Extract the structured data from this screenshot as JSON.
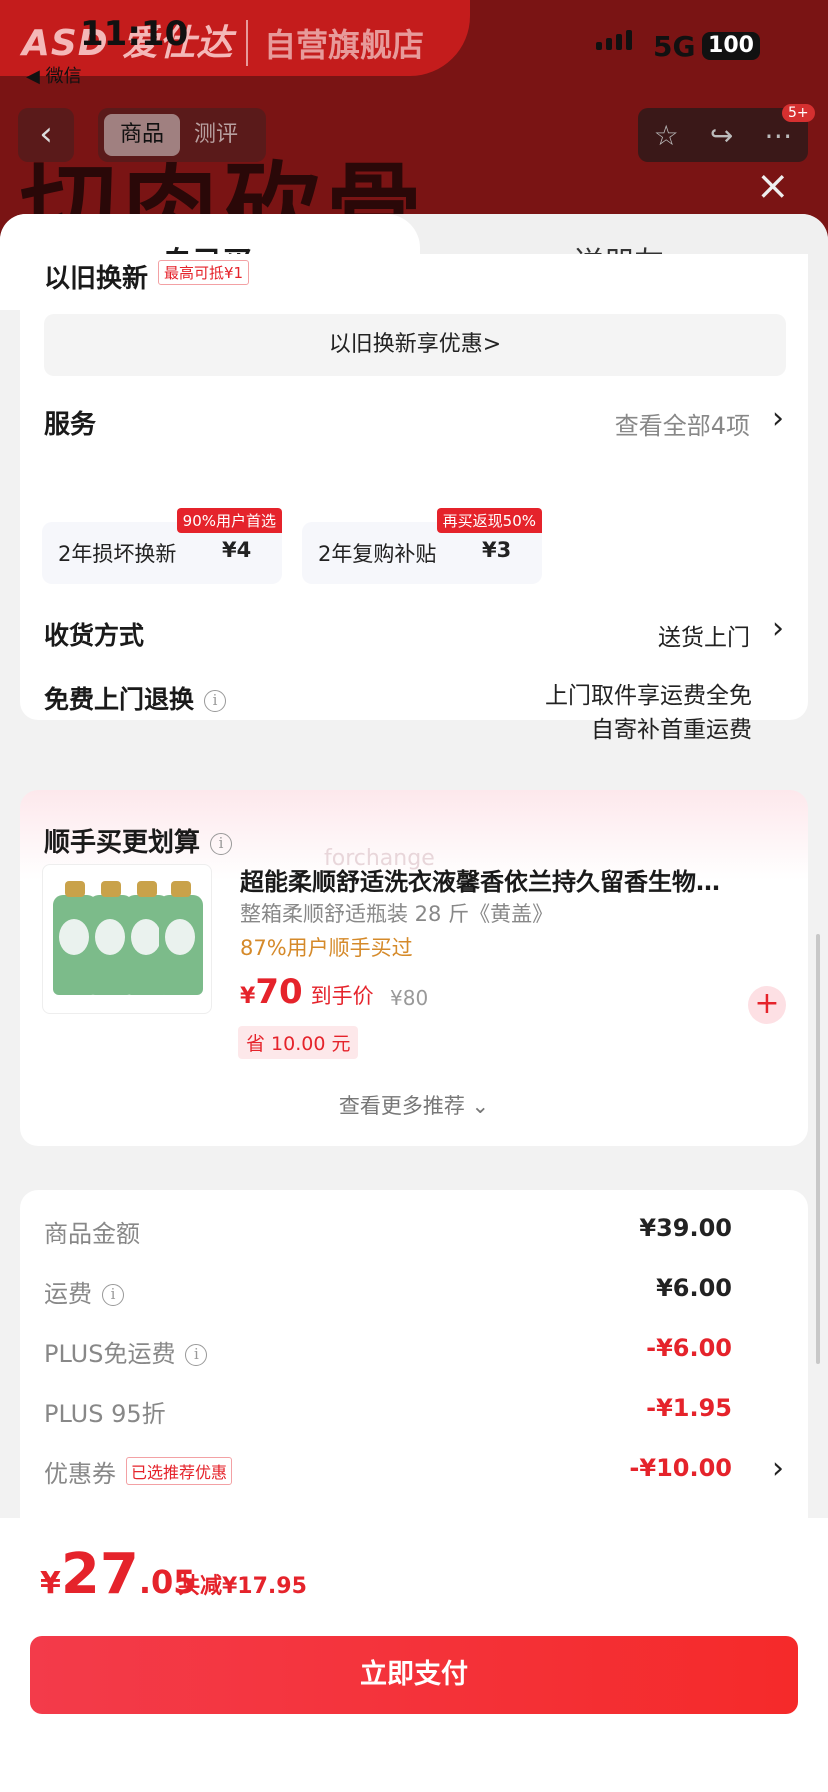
{
  "status_bar": {
    "time": "11:10",
    "back_app": "◀ 微信",
    "network": "5G",
    "battery": "100"
  },
  "background_page": {
    "brand": "ASD 爱仕达",
    "shop": "自营旗舰店",
    "nav_tabs": [
      "商品",
      "测评"
    ],
    "banner_text": "切肉砍骨",
    "notification_badge": "5+"
  },
  "sheet": {
    "tabs": {
      "self": "自己买",
      "gift": "送朋友"
    },
    "tradein": {
      "title": "以旧换新",
      "tag": "最高可抵¥1",
      "button": "以旧换新享优惠>"
    },
    "service": {
      "title": "服务",
      "view_all": "查看全部4项",
      "items": [
        {
          "name": "2年损坏换新",
          "price": "¥4",
          "badge": "90%用户首选"
        },
        {
          "name": "2年复购补贴",
          "price": "¥3",
          "badge": "再买返现50%"
        }
      ]
    },
    "delivery": {
      "label": "收货方式",
      "value": "送货上门"
    },
    "free_return": {
      "label": "免费上门退换",
      "line1": "上门取件享运费全免",
      "line2": "自寄补首重运费"
    },
    "recommend": {
      "title": "顺手买更划算",
      "watermark": "forchange",
      "product": {
        "name": "超能柔顺舒适洗衣液馨香依兰持久留香生物…",
        "spec": "整箱柔顺舒适瓶装 28 斤《黄盖》",
        "buyers": "87%用户顺手买过",
        "yen": "¥",
        "price": "70",
        "price_label": "到手价",
        "orig_price": "¥80",
        "save": "省 10.00 元"
      },
      "more": "查看更多推荐"
    },
    "fees": [
      {
        "label": "商品金额",
        "amount": "¥39.00",
        "red": false
      },
      {
        "label": "运费",
        "amount": "¥6.00",
        "red": false
      },
      {
        "label": "PLUS免运费",
        "amount": "-¥6.00",
        "red": true
      },
      {
        "label": "PLUS 95折",
        "amount": "-¥1.95",
        "red": true
      },
      {
        "label": "优惠券",
        "amount": "-¥10.00",
        "red": true,
        "tag": "已选推荐优惠"
      }
    ],
    "bottom": {
      "yen": "¥",
      "total_int": "27",
      "total_dec": ".05",
      "saved": "共减¥17.95",
      "pay": "立即支付"
    }
  },
  "colors": {
    "accent_red": "#e5232b",
    "buyers_orange": "#d58a2a"
  }
}
